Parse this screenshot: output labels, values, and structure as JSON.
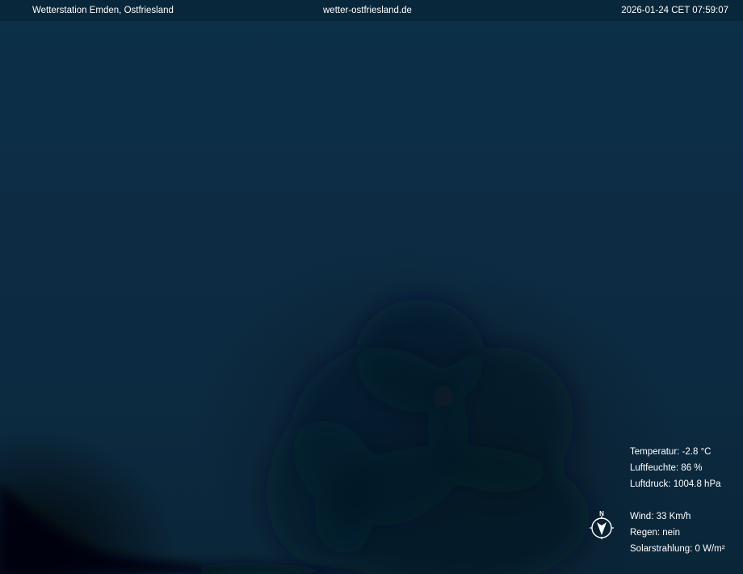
{
  "header": {
    "station_name": "Wetterstation Emden, Ostfriesland",
    "website": "wetter-ostfriesland.de",
    "timestamp": "2026-01-24 CET 07:59:07"
  },
  "readings": {
    "temperature": "Temperatur: -2.8 °C",
    "humidity": "Luftfeuchte: 86 %",
    "pressure": "Luftdruck: 1004.8 hPa",
    "wind": "Wind: 33 Km/h",
    "rain": "Regen: nein",
    "solar": "Solarstrahlung: 0 W/m²"
  },
  "compass": {
    "north_label": "N",
    "icon": "wind-direction-compass-icon"
  },
  "colors": {
    "sky": "#0b3048",
    "text": "#ffffff"
  }
}
